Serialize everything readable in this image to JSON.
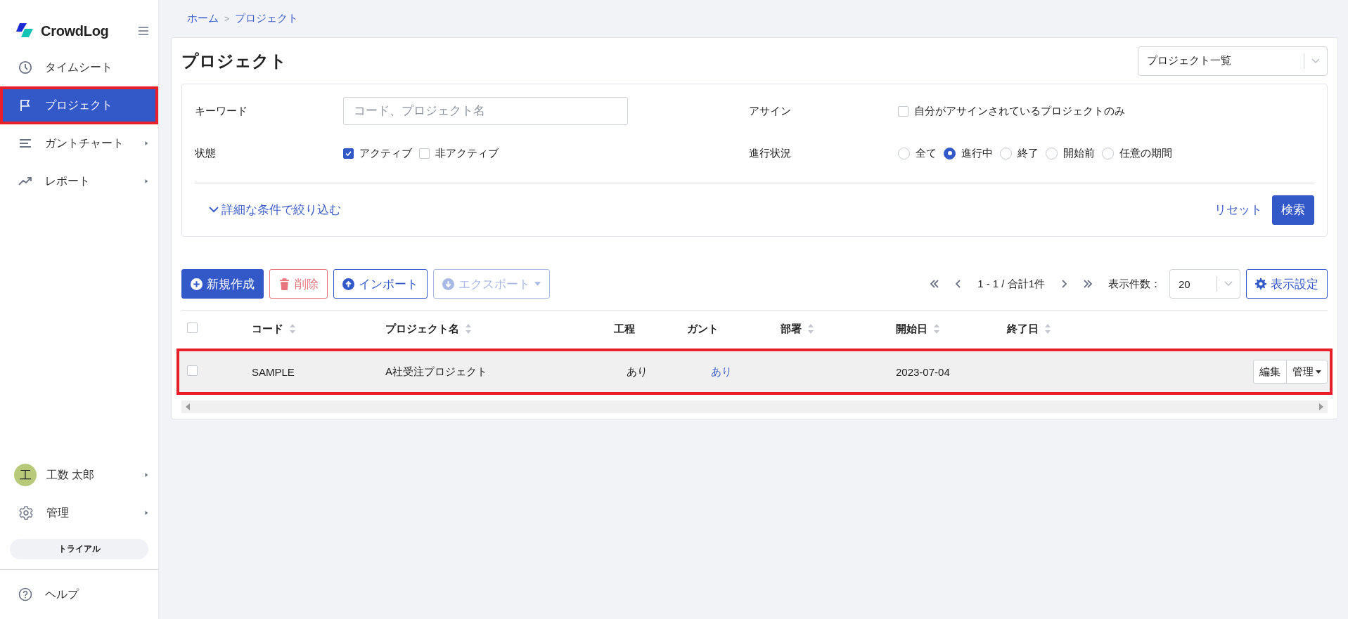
{
  "sidebar": {
    "logo": "CrowdLog",
    "nav": [
      {
        "label": "タイムシート",
        "selected": false,
        "highlighted": false,
        "has_submenu": false
      },
      {
        "label": "プロジェクト",
        "selected": true,
        "highlighted": true,
        "has_submenu": false
      },
      {
        "label": "ガントチャート",
        "selected": false,
        "highlighted": false,
        "has_submenu": true
      },
      {
        "label": "レポート",
        "selected": false,
        "highlighted": false,
        "has_submenu": true
      }
    ],
    "user": {
      "avatar": "工",
      "name": "工数 太郎"
    },
    "admin": "管理",
    "plan": "トライアル",
    "help": "ヘルプ"
  },
  "breadcrumb": {
    "items": [
      "ホーム",
      "プロジェクト"
    ],
    "separator": ">"
  },
  "page_title": "プロジェクト",
  "view_select": "プロジェクト一覧",
  "filters": {
    "keyword": {
      "label": "キーワード",
      "placeholder": "コード、プロジェクト名"
    },
    "assign": {
      "label": "アサイン",
      "option": {
        "label": "自分がアサインされているプロジェクトのみ",
        "checked": false
      }
    },
    "status": {
      "label": "状態",
      "options": [
        {
          "label": "アクティブ",
          "checked": true
        },
        {
          "label": "非アクティブ",
          "checked": false
        }
      ]
    },
    "progress": {
      "label": "進行状況",
      "options": [
        {
          "label": "全て",
          "selected": false
        },
        {
          "label": "進行中",
          "selected": true
        },
        {
          "label": "終了",
          "selected": false
        },
        {
          "label": "開始前",
          "selected": false
        },
        {
          "label": "任意の期間",
          "selected": false
        }
      ]
    },
    "advanced": "詳細な条件で絞り込む",
    "reset": "リセット",
    "search": "検索"
  },
  "toolbar": {
    "buttons": [
      {
        "label": "新規作成",
        "kind": "primary",
        "disabled": false
      },
      {
        "label": "削除",
        "kind": "danger",
        "disabled": true
      },
      {
        "label": "インポート",
        "kind": "outline",
        "disabled": false
      },
      {
        "label": "エクスポート",
        "kind": "outline",
        "disabled": true
      }
    ],
    "pagination": "1 - 1 / 合計1件",
    "page_size_label": "表示件数：",
    "page_size": "20",
    "settings": "表示設定"
  },
  "table": {
    "select_all_checked": false,
    "columns": [
      {
        "label": "コード",
        "sortable": true
      },
      {
        "label": "プロジェクト名",
        "sortable": true
      },
      {
        "label": "工程",
        "sortable": false
      },
      {
        "label": "ガント",
        "sortable": false
      },
      {
        "label": "部署",
        "sortable": true
      },
      {
        "label": "開始日",
        "sortable": true
      },
      {
        "label": "終了日",
        "sortable": true
      }
    ],
    "rows": [
      {
        "checked": false,
        "highlighted": true,
        "code": "SAMPLE",
        "name": "A社受注プロジェクト",
        "process": "あり",
        "gantt": "あり",
        "start_date": "2023-07-04",
        "actions": [
          "編集",
          "管理"
        ]
      }
    ]
  }
}
